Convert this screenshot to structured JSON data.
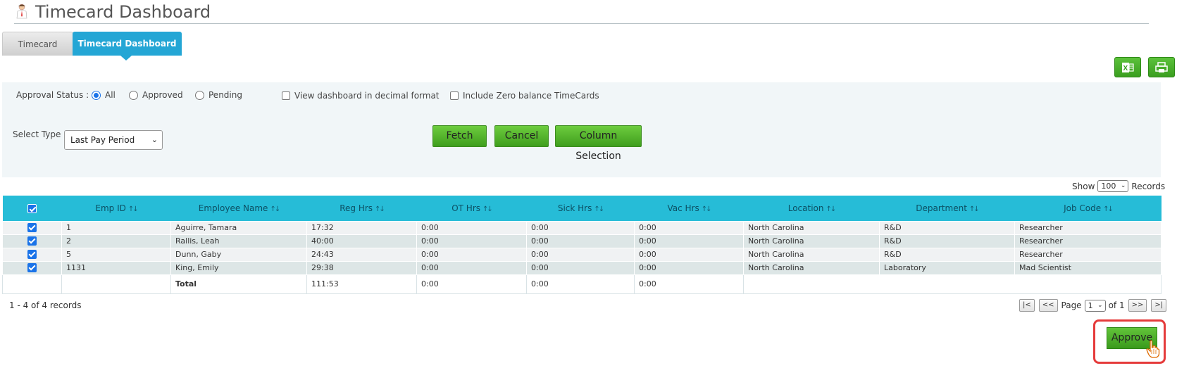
{
  "header": {
    "title": "Timecard Dashboard",
    "icon": "person-icon"
  },
  "tabs": [
    {
      "label": "Timecard",
      "active": false
    },
    {
      "label": "Timecard Dashboard",
      "active": true
    }
  ],
  "toolbar": {
    "excel_icon": "excel-icon",
    "print_icon": "printer-icon"
  },
  "filters": {
    "approval_status_label": "Approval Status :",
    "approval_options": [
      {
        "label": "All",
        "selected": true
      },
      {
        "label": "Approved",
        "selected": false
      },
      {
        "label": "Pending",
        "selected": false
      }
    ],
    "decimal_format_label": "View dashboard in decimal format",
    "decimal_format_checked": false,
    "zero_balance_label": "Include Zero balance TimeCards",
    "zero_balance_checked": false,
    "select_type_label": "Select Type",
    "select_type_value": "Last Pay Period",
    "fetch_label": "Fetch",
    "cancel_label": "Cancel",
    "column_selection_label": "Column Selection"
  },
  "records_control": {
    "show_label": "Show",
    "page_size": "100",
    "records_label": "Records"
  },
  "table": {
    "columns": [
      "Emp ID",
      "Employee Name",
      "Reg Hrs",
      "OT Hrs",
      "Sick Hrs",
      "Vac Hrs",
      "Location",
      "Department",
      "Job Code"
    ],
    "rows": [
      {
        "emp_id": "1",
        "name": "Aguirre, Tamara",
        "reg": "17:32",
        "ot": "0:00",
        "sick": "0:00",
        "vac": "0:00",
        "location": "North Carolina",
        "department": "R&D",
        "job": "Researcher"
      },
      {
        "emp_id": "2",
        "name": "Rallis, Leah",
        "reg": "40:00",
        "ot": "0:00",
        "sick": "0:00",
        "vac": "0:00",
        "location": "North Carolina",
        "department": "R&D",
        "job": "Researcher"
      },
      {
        "emp_id": "5",
        "name": "Dunn, Gaby",
        "reg": "24:43",
        "ot": "0:00",
        "sick": "0:00",
        "vac": "0:00",
        "location": "North Carolina",
        "department": "R&D",
        "job": "Researcher"
      },
      {
        "emp_id": "1131",
        "name": "King, Emily",
        "reg": "29:38",
        "ot": "0:00",
        "sick": "0:00",
        "vac": "0:00",
        "location": "North Carolina",
        "department": "Laboratory",
        "job": "Mad Scientist"
      }
    ],
    "total": {
      "label": "Total",
      "reg": "111:53",
      "ot": "0:00",
      "sick": "0:00",
      "vac": "0:00"
    }
  },
  "pagination": {
    "summary": "1 - 4 of 4 records",
    "first": "|<",
    "prev": "<<",
    "page_label": "Page",
    "page_value": "1",
    "of_label": "of 1",
    "next": ">>",
    "last": ">|"
  },
  "actions": {
    "approve_label": "Approve"
  }
}
